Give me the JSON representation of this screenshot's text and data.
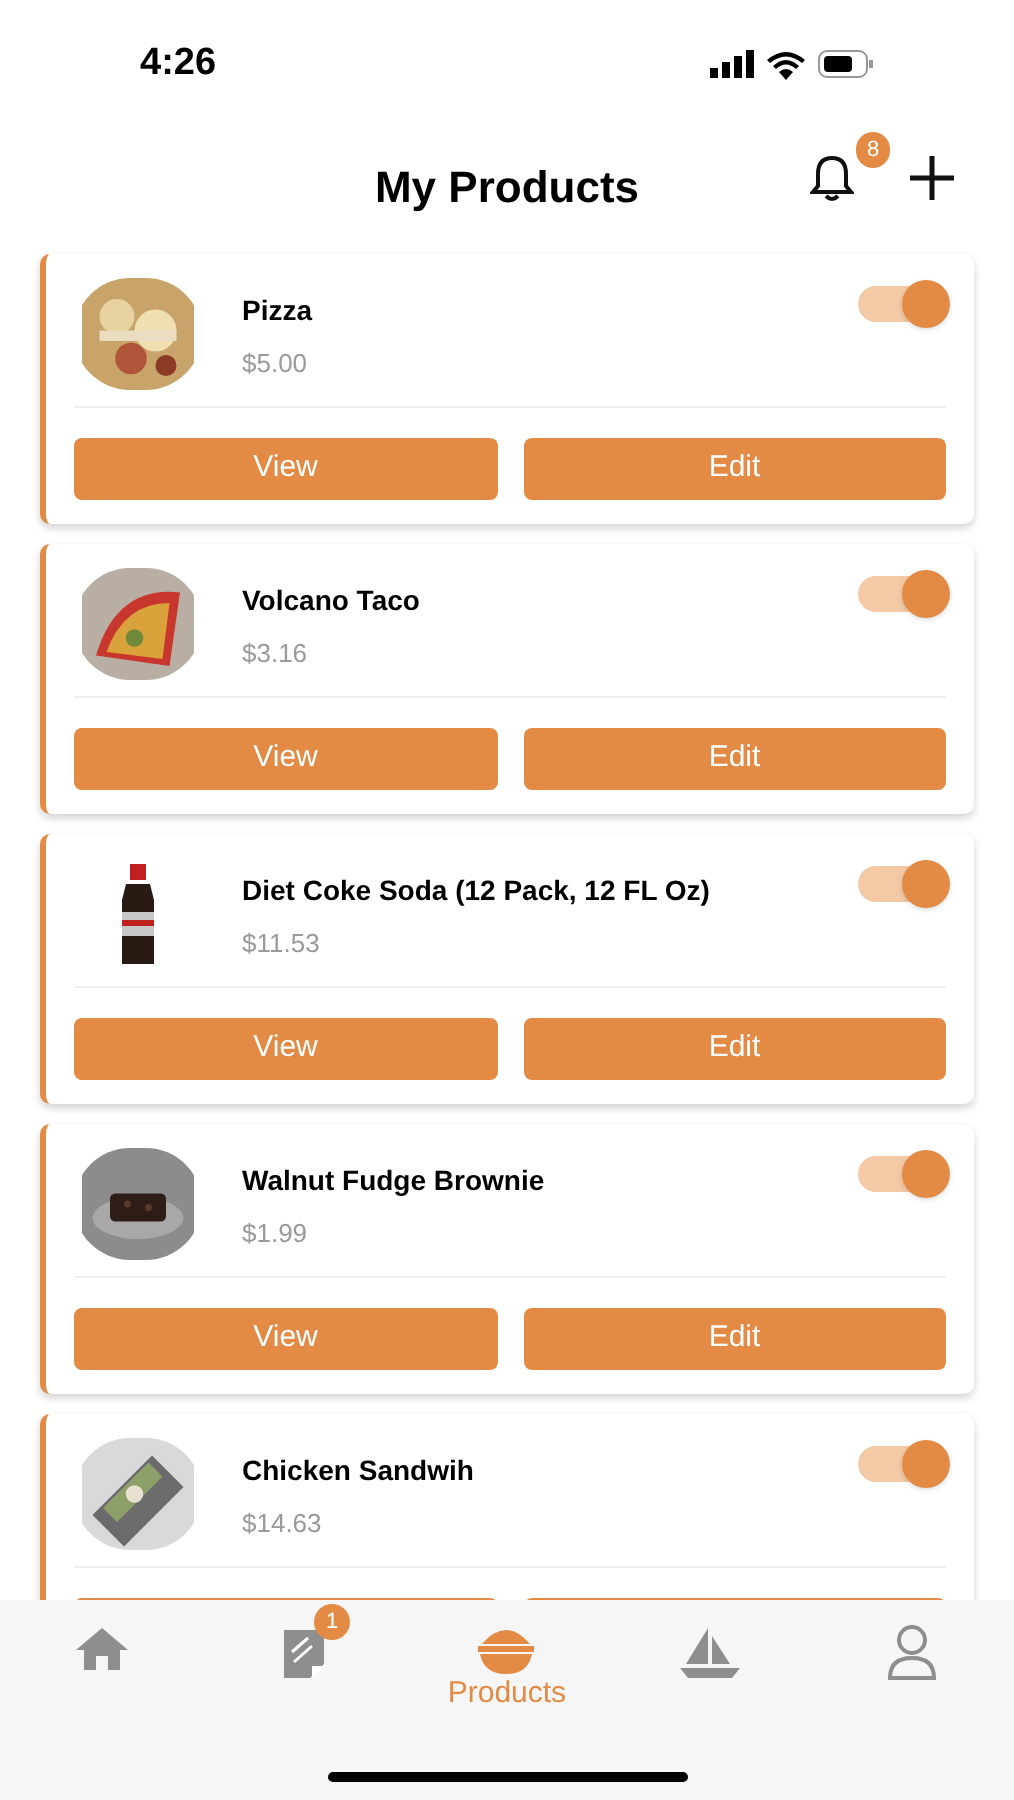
{
  "status_bar": {
    "time": "4:26"
  },
  "header": {
    "title": "My Products",
    "notification_count": "8"
  },
  "products": [
    {
      "name": "Pizza",
      "price": "$5.00",
      "kind": "pizza",
      "active": true,
      "actions": [
        "View",
        "Edit"
      ]
    },
    {
      "name": "Volcano Taco",
      "price": "$3.16",
      "kind": "taco",
      "active": true,
      "actions": [
        "View",
        "Edit"
      ]
    },
    {
      "name": "Diet Coke Soda (12 Pack, 12 FL Oz)",
      "price": "$11.53",
      "kind": "bottle",
      "active": true,
      "actions": [
        "View",
        "Edit"
      ]
    },
    {
      "name": "Walnut Fudge Brownie",
      "price": "$1.99",
      "kind": "brownie",
      "active": true,
      "actions": [
        "View",
        "Edit"
      ]
    },
    {
      "name": "Chicken Sandwih",
      "price": "$14.63",
      "kind": "wrap",
      "active": true
    }
  ],
  "tabs": [
    {
      "kind": "home",
      "selected": false
    },
    {
      "kind": "orders",
      "selected": false,
      "badge": "1"
    },
    {
      "kind": "products",
      "selected": true,
      "label": "Products"
    },
    {
      "kind": "boat",
      "selected": false
    },
    {
      "kind": "profile",
      "selected": false
    }
  ]
}
